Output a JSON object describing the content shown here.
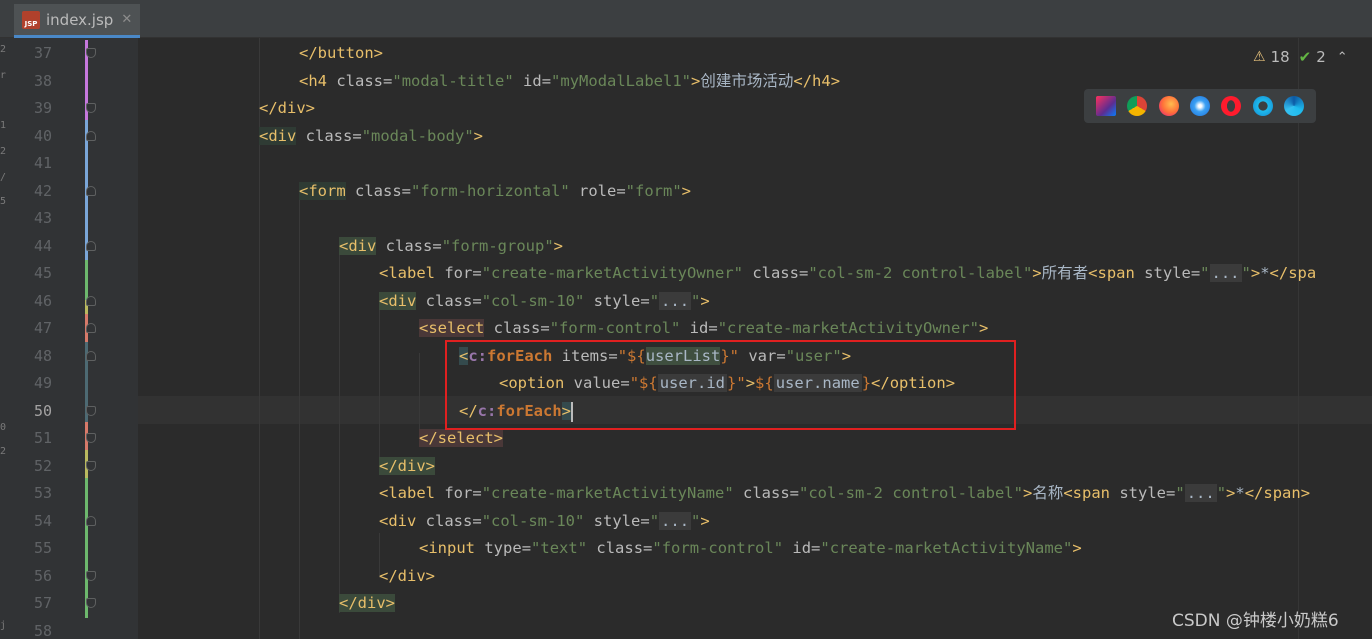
{
  "tab": {
    "filename": "index.jsp",
    "icon_label": "JSP",
    "close": "✕"
  },
  "inspections": {
    "warnings": "18",
    "ok": "2",
    "warn_icon": "⚠",
    "ok_icon": "✔",
    "nav": "⌃"
  },
  "browsers": [
    "intellij-icon",
    "chrome-icon",
    "firefox-icon",
    "safari-icon",
    "opera-icon",
    "ie-icon",
    "edge-icon"
  ],
  "left_strip_chars": [
    "2",
    "r",
    "1",
    "2",
    "/",
    "5",
    "0",
    "2",
    "j"
  ],
  "current_line": "50",
  "line_numbers": [
    "37",
    "38",
    "39",
    "40",
    "41",
    "42",
    "43",
    "44",
    "45",
    "46",
    "47",
    "48",
    "49",
    "50",
    "51",
    "52",
    "53",
    "54",
    "55",
    "56",
    "57",
    "58"
  ],
  "watermark": "CSDN @钟楼小奶糕6",
  "code": {
    "l37": {
      "o": "</",
      "t": "button",
      "c": ">"
    },
    "l38": {
      "o": "<",
      "t": "h4",
      "a1": " class",
      "eq1": "=",
      "v1": "\"modal-title\"",
      "a2": " id",
      "eq2": "=",
      "v2": "\"myModalLabel1\"",
      "c": ">",
      "text": "创建市场活动",
      "co": "</",
      "ct": "h4",
      "cc": ">"
    },
    "l39": {
      "o": "</",
      "t": "div",
      "c": ">"
    },
    "l40": {
      "o": "<",
      "t": "div",
      "a1": " class",
      "eq1": "=",
      "v1": "\"modal-body\"",
      "c": ">"
    },
    "l42": {
      "o": "<",
      "t": "form",
      "a1": " class",
      "eq1": "=",
      "v1": "\"form-horizontal\"",
      "a2": " role",
      "eq2": "=",
      "v2": "\"form\"",
      "c": ">"
    },
    "l44": {
      "o": "<",
      "t": "div",
      "a1": " class",
      "eq1": "=",
      "v1": "\"form-group\"",
      "c": ">"
    },
    "l45": {
      "o": "<",
      "t": "label",
      "a1": " for",
      "eq1": "=",
      "v1": "\"create-marketActivityOwner\"",
      "a2": " class",
      "eq2": "=",
      "v2": "\"col-sm-2 control-label\"",
      "c": ">",
      "text": "所有者",
      "so": "<",
      "st": "span",
      "sa": " style",
      "seq": "=",
      "sq1": "\"",
      "sph": "...",
      "sq2": "\"",
      "sc": ">",
      "star": "*",
      "sco": "</",
      "sct": "spa"
    },
    "l46": {
      "o": "<",
      "t": "div",
      "a1": " class",
      "eq1": "=",
      "v1": "\"col-sm-10\"",
      "a2": " style",
      "eq2": "=",
      "q1": "\"",
      "ph": "...",
      "q2": "\"",
      "c": ">"
    },
    "l47": {
      "o": "<",
      "t": "select",
      "a1": " class",
      "eq1": "=",
      "v1": "\"form-control\"",
      "a2": " id",
      "eq2": "=",
      "v2": "\"create-marketActivityOwner\"",
      "c": ">"
    },
    "l48": {
      "o": "<",
      "p": "c:",
      "t": "forEach",
      "a1": " items",
      "eq1": "=",
      "v1a": "\"${",
      "v1b": "userList",
      "v1c": "}\"",
      "a2": " var",
      "eq2": "=",
      "v2": "\"user\"",
      "c": ">"
    },
    "l49": {
      "o": "<",
      "t": "option",
      "a1": " value",
      "eq1": "=",
      "v1a": "\"${",
      "v1b": "user.id",
      "v1c": "}\"",
      "c": ">",
      "e1": "${",
      "e2": "user.name",
      "e3": "}",
      "co": "</",
      "ct": "option",
      "cc": ">"
    },
    "l50": {
      "o": "</",
      "p": "c:",
      "t": "forEach",
      "c": ">"
    },
    "l51": {
      "o": "</",
      "t": "select",
      "c": ">"
    },
    "l52": {
      "o": "</",
      "t": "div",
      "c": ">"
    },
    "l53": {
      "o": "<",
      "t": "label",
      "a1": " for",
      "eq1": "=",
      "v1": "\"create-marketActivityName\"",
      "a2": " class",
      "eq2": "=",
      "v2": "\"col-sm-2 control-label\"",
      "c": ">",
      "text": "名称",
      "so": "<",
      "st": "span",
      "sa": " style",
      "seq": "=",
      "sq1": "\"",
      "sph": "...",
      "sq2": "\"",
      "sc": ">",
      "star": "*",
      "sco": "</",
      "sct": "span",
      "scc": ">"
    },
    "l54": {
      "o": "<",
      "t": "div",
      "a1": " class",
      "eq1": "=",
      "v1": "\"col-sm-10\"",
      "a2": " style",
      "eq2": "=",
      "q1": "\"",
      "ph": "...",
      "q2": "\"",
      "c": ">"
    },
    "l55": {
      "o": "<",
      "t": "input",
      "a1": " type",
      "eq1": "=",
      "v1": "\"text\"",
      "a2": " class",
      "eq2": "=",
      "v2": "\"form-control\"",
      "a3": " id",
      "eq3": "=",
      "v3": "\"create-marketActivityName\"",
      "c": ">"
    },
    "l56": {
      "o": "</",
      "t": "div",
      "c": ">"
    },
    "l57": {
      "o": "</",
      "t": "div",
      "c": ">"
    }
  }
}
